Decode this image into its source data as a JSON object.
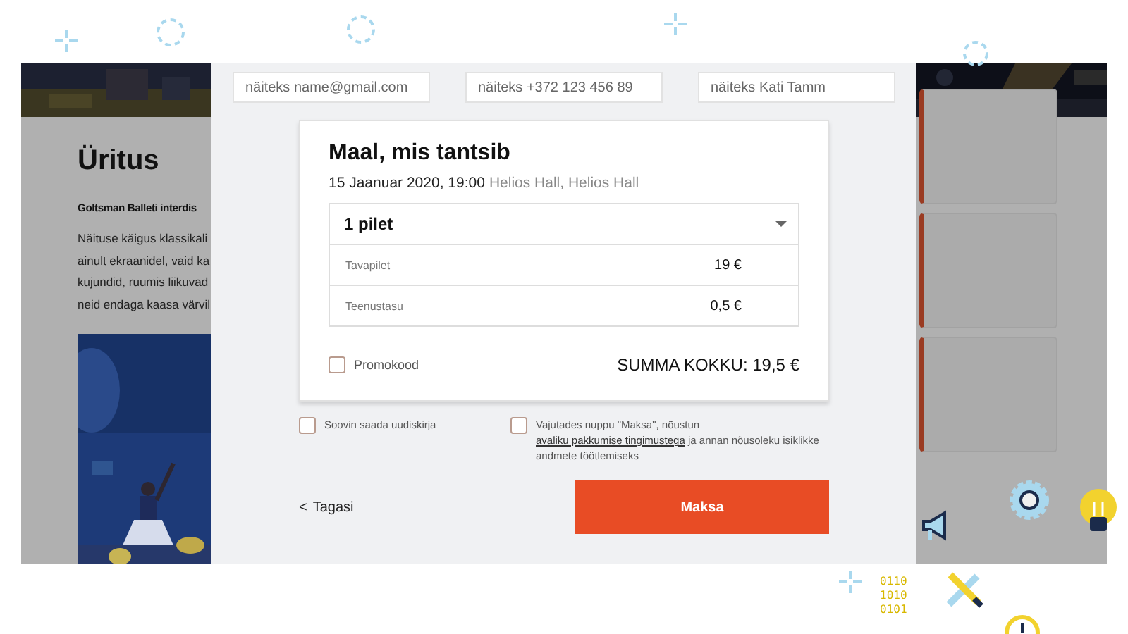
{
  "background_page": {
    "heading": "Üritus",
    "subtitle": "Goltsman Balleti interdis",
    "paragraph_lines": [
      "Näituse käigus klassikali",
      "ainult ekraanidel, vaid ka",
      "kujundid, ruumis liikuvad",
      "neid endaga kaasa värvil"
    ],
    "side_cards": [
      {
        "kind": "card"
      },
      {
        "kind": "card"
      },
      {
        "kind": "card"
      }
    ]
  },
  "contact_fields": [
    {
      "placeholder": "näiteks name@gmail.com"
    },
    {
      "placeholder": "näiteks +372 123 456 89"
    },
    {
      "placeholder": "näiteks Kati Tamm"
    }
  ],
  "event": {
    "title": "Maal, mis tantsib",
    "datetime": "15 Jaanuar 2020, 19:00",
    "venue": "Helios Hall, Helios Hall"
  },
  "ticket_select": {
    "value": "1 pilet"
  },
  "price_rows": [
    {
      "label": "Tavapilet",
      "amount": "19 €"
    },
    {
      "label": "Teenustasu",
      "amount": "0,5 €"
    }
  ],
  "promo": {
    "label": "Promokood",
    "checked": false
  },
  "total": "SUMMA KOKKU: 19,5 €",
  "newsletter": {
    "label": "Soovin saada uudiskirja",
    "checked": false
  },
  "consent": {
    "checked": false,
    "before": "Vajutades nuppu \"Maksa\", nõustun ",
    "link": "avaliku pakkumise tingimustega",
    "after": " ja annan nõusoleku isiklikke andmete töötlemiseks"
  },
  "back_link": {
    "icon": "<",
    "label": "Tagasi"
  },
  "pay_button": "Maksa",
  "decoration": {
    "binary_lines": [
      "0110",
      "1010",
      "0101"
    ]
  }
}
